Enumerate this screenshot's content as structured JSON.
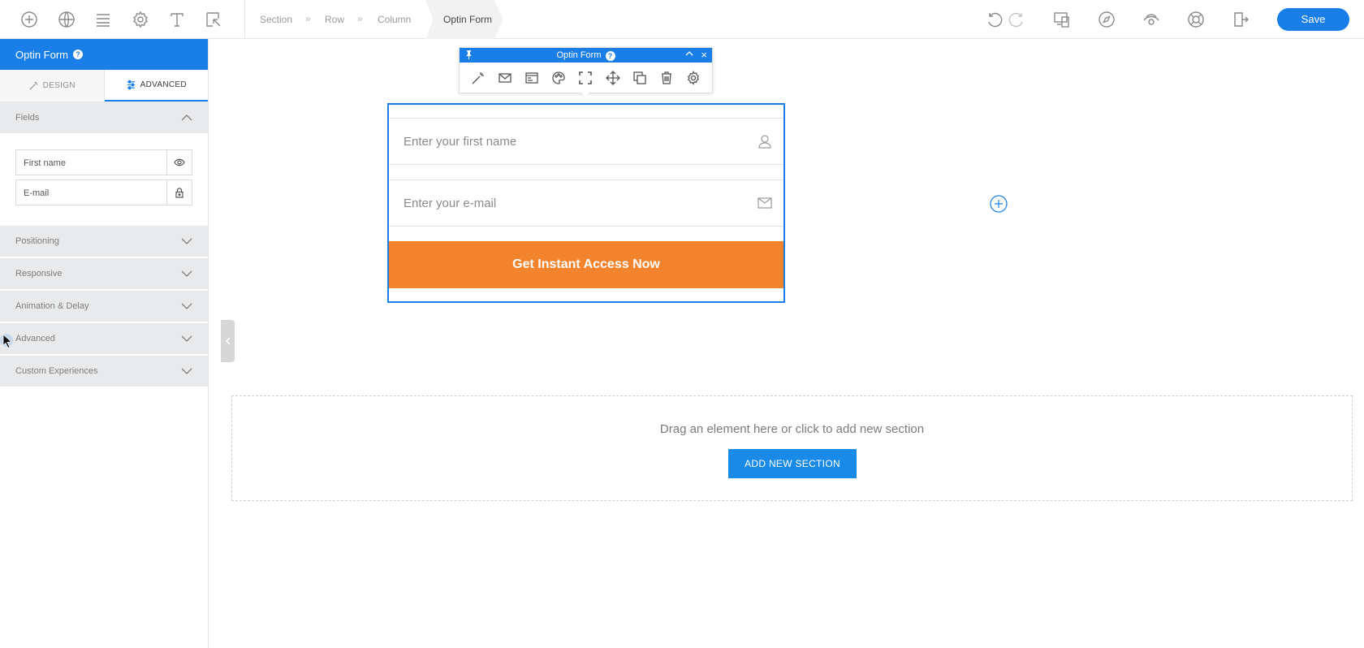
{
  "topbar": {
    "breadcrumbs": [
      "Section",
      "Row",
      "Column"
    ],
    "separator": "»",
    "active_crumb": "Optin Form",
    "save_label": "Save"
  },
  "left_panel": {
    "title": "Optin Form",
    "help_glyph": "?",
    "tabs": [
      {
        "label": "DESIGN",
        "icon": "magic-wand-icon"
      },
      {
        "label": "ADVANCED",
        "icon": "sliders-icon"
      }
    ],
    "fields_section": {
      "label": "Fields",
      "items": [
        {
          "name": "First name",
          "action_icon": "eye-icon"
        },
        {
          "name": "E-mail",
          "action_icon": "lock-icon"
        }
      ]
    },
    "accordion": [
      "Positioning",
      "Responsive",
      "Animation & Delay",
      "Advanced",
      "Custom Experiences"
    ]
  },
  "element_toolbar": {
    "title": "Optin Form",
    "help_glyph": "?",
    "close_glyph": "×"
  },
  "form": {
    "first_name_placeholder": "Enter your first name",
    "email_placeholder": "Enter your e-mail",
    "button_label": "Get Instant Access Now"
  },
  "drop_zone": {
    "text": "Drag an element here or click to add new section",
    "button_label": "ADD NEW SECTION"
  },
  "colors": {
    "accent": "#1a7ee8",
    "cta": "#f4832e"
  }
}
